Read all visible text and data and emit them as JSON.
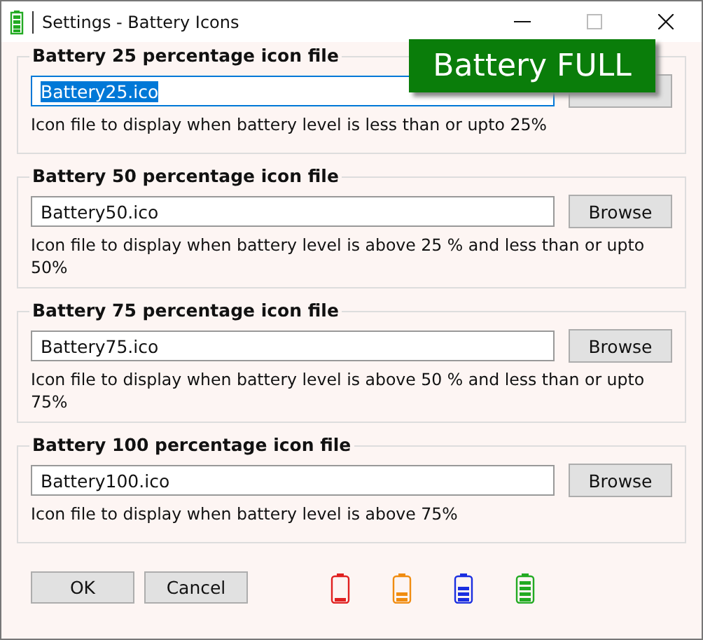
{
  "window": {
    "title": "Settings - Battery Icons"
  },
  "groups": [
    {
      "title": "Battery 25 percentage icon file",
      "value": "Battery25.ico",
      "value_selected": true,
      "description": "Icon file to display when battery level is less than or upto 25%"
    },
    {
      "title": "Battery 50 percentage icon file",
      "value": "Battery50.ico",
      "value_selected": false,
      "button": "Browse",
      "description": "Icon file to display when battery level is above 25 % and less than or upto 50%"
    },
    {
      "title": "Battery 75 percentage icon file",
      "value": "Battery75.ico",
      "value_selected": false,
      "button": "Browse",
      "description": "Icon file to display when battery level is above 50 % and less than or upto 75%"
    },
    {
      "title": "Battery 100 percentage icon file",
      "value": "Battery100.ico",
      "value_selected": false,
      "button": "Browse",
      "description": "Icon file to display when battery level is above 75%"
    }
  ],
  "buttons": [
    "OK",
    "Cancel"
  ],
  "battery_icons": [
    {
      "color": "#e02020"
    },
    {
      "color": "#f08c10"
    },
    {
      "color": "#1a2ee0"
    },
    {
      "color": "#22aa22"
    }
  ],
  "overlay": {
    "text": "Battery FULL"
  }
}
